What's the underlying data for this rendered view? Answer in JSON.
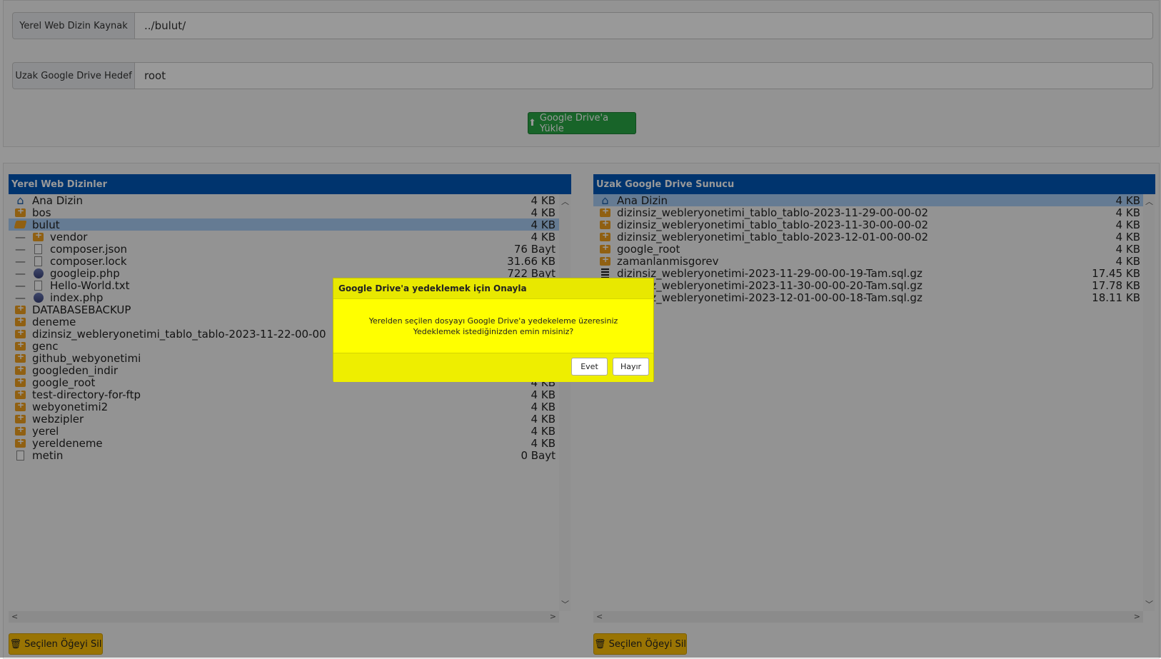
{
  "form": {
    "local_label": "Yerel Web Dizin Kaynak",
    "local_value": "../bulut/",
    "remote_label": "Uzak Google Drive Hedef",
    "remote_value": "root",
    "upload_button": "Google Drive'a Yükle"
  },
  "left_panel": {
    "title": "Yerel Web Dizinler",
    "items": [
      {
        "name": "Ana Dizin",
        "size": "4 KB",
        "icon": "home-icon",
        "indent": 0
      },
      {
        "name": "bos",
        "size": "4 KB",
        "icon": "folder-icon",
        "indent": 0
      },
      {
        "name": "bulut",
        "size": "4 KB",
        "icon": "folder-open-icon",
        "indent": 0,
        "selected": true
      },
      {
        "name": "vendor",
        "size": "4 KB",
        "icon": "folder-icon",
        "indent": 1
      },
      {
        "name": "composer.json",
        "size": "76 Bayt",
        "icon": "file-icon",
        "indent": 1
      },
      {
        "name": "composer.lock",
        "size": "31.66 KB",
        "icon": "file-icon",
        "indent": 1
      },
      {
        "name": "googleip.php",
        "size": "722 Bayt",
        "icon": "php-icon",
        "indent": 1
      },
      {
        "name": "Hello-World.txt",
        "size": "",
        "icon": "file-icon",
        "indent": 1
      },
      {
        "name": "index.php",
        "size": "",
        "icon": "php-icon",
        "indent": 1
      },
      {
        "name": "DATABASEBACKUP",
        "size": "",
        "icon": "folder-icon",
        "indent": 0
      },
      {
        "name": "deneme",
        "size": "",
        "icon": "folder-icon",
        "indent": 0
      },
      {
        "name": "dizinsiz_webleryonetimi_tablo_tablo-2023-11-22-00-00",
        "size": "",
        "icon": "folder-icon",
        "indent": 0
      },
      {
        "name": "genc",
        "size": "",
        "icon": "folder-icon",
        "indent": 0
      },
      {
        "name": "github_webyonetimi",
        "size": "",
        "icon": "folder-icon",
        "indent": 0
      },
      {
        "name": "googleden_indir",
        "size": "",
        "icon": "folder-icon",
        "indent": 0
      },
      {
        "name": "google_root",
        "size": "4 KB",
        "icon": "folder-icon",
        "indent": 0
      },
      {
        "name": "test-directory-for-ftp",
        "size": "4 KB",
        "icon": "folder-icon",
        "indent": 0
      },
      {
        "name": "webyonetimi2",
        "size": "4 KB",
        "icon": "folder-icon",
        "indent": 0
      },
      {
        "name": "webzipler",
        "size": "4 KB",
        "icon": "folder-icon",
        "indent": 0
      },
      {
        "name": "yerel",
        "size": "4 KB",
        "icon": "folder-icon",
        "indent": 0
      },
      {
        "name": "yereldeneme",
        "size": "4 KB",
        "icon": "folder-icon",
        "indent": 0
      },
      {
        "name": "metin",
        "size": "0 Bayt",
        "icon": "file-icon",
        "indent": 0
      }
    ],
    "delete_button": "Seçilen Öğeyi Sil"
  },
  "right_panel": {
    "title": "Uzak Google Drive Sunucu",
    "items": [
      {
        "name": "Ana Dizin",
        "size": "4 KB",
        "icon": "home-icon",
        "selected": true
      },
      {
        "name": "dizinsiz_webleryonetimi_tablo_tablo-2023-11-29-00-00-02",
        "size": "4 KB",
        "icon": "folder-icon"
      },
      {
        "name": "dizinsiz_webleryonetimi_tablo_tablo-2023-11-30-00-00-02",
        "size": "4 KB",
        "icon": "folder-icon"
      },
      {
        "name": "dizinsiz_webleryonetimi_tablo_tablo-2023-12-01-00-00-02",
        "size": "4 KB",
        "icon": "folder-icon"
      },
      {
        "name": "google_root",
        "size": "4 KB",
        "icon": "folder-icon"
      },
      {
        "name": "zamanlanmisgorev",
        "size": "4 KB",
        "icon": "folder-icon"
      },
      {
        "name": "dizinsiz_webleryonetimi-2023-11-29-00-00-19-Tam.sql.gz",
        "size": "17.45 KB",
        "icon": "archive-icon"
      },
      {
        "name": "dizinsiz_webleryonetimi-2023-11-30-00-00-20-Tam.sql.gz",
        "size": "17.78 KB",
        "icon": "archive-icon"
      },
      {
        "name": "dizinsiz_webleryonetimi-2023-12-01-00-00-18-Tam.sql.gz",
        "size": "18.11 KB",
        "icon": "archive-icon"
      }
    ],
    "delete_button": "Seçilen Öğeyi Sil"
  },
  "dialog": {
    "title": "Google Drive'a yedeklemek için Onayla",
    "line1": "Yerelden seçilen dosyayı Google Drive'a yedekeleme üzeresiniz",
    "line2": "Yedeklemek istediğinizden emin misiniz?",
    "yes": "Evet",
    "no": "Hayır"
  },
  "colors": {
    "header": "#0057b8",
    "upload": "#28a745",
    "delete": "#ffc107",
    "dialog": "#ffff00"
  }
}
